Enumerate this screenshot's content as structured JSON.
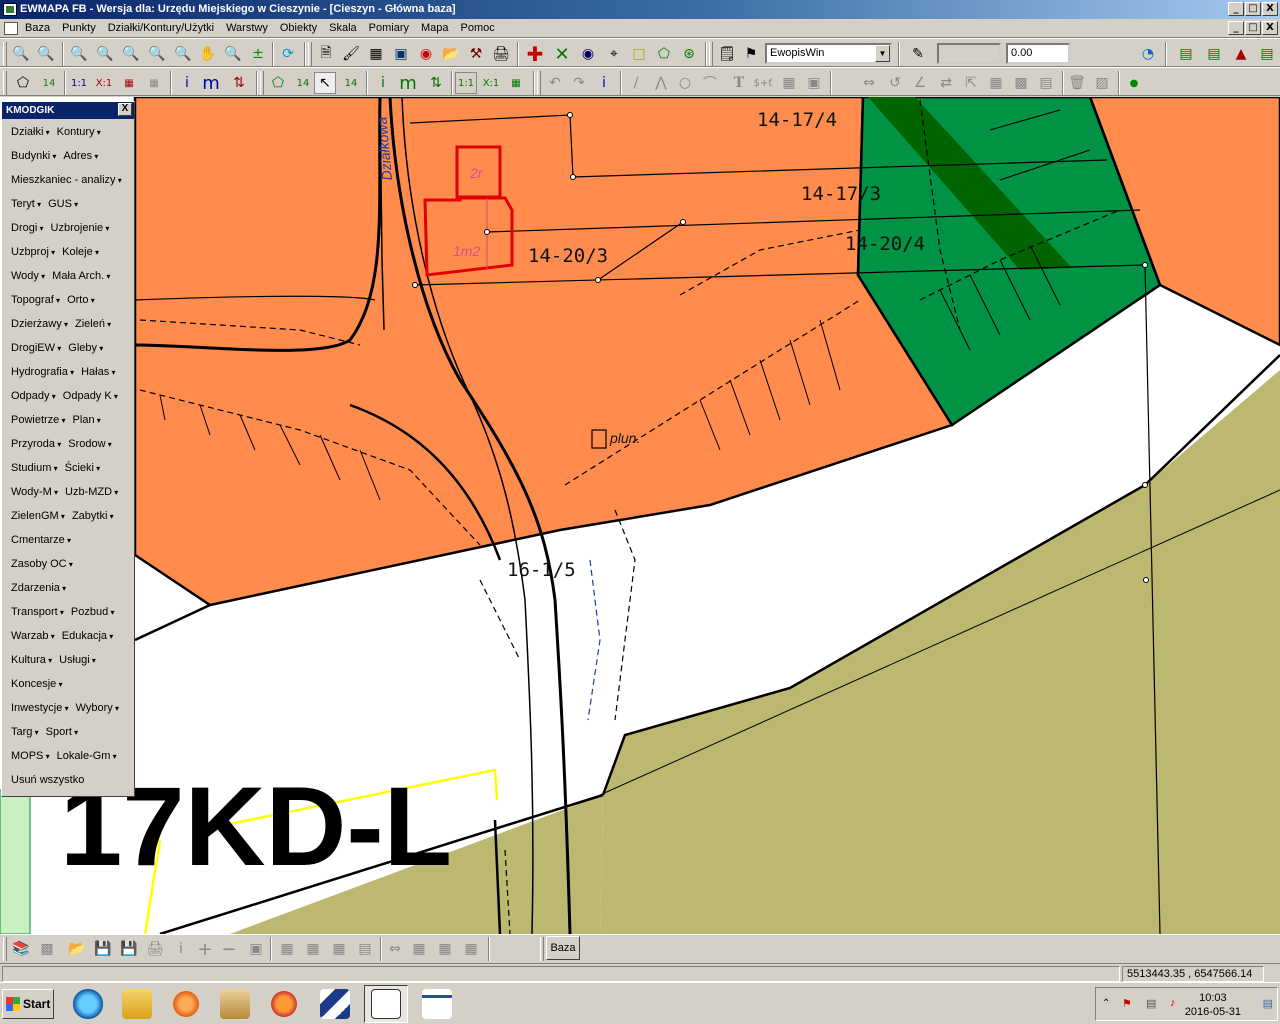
{
  "window": {
    "title": "EWMAPA FB - Wersja dla: Urzędu Miejskiego w Cieszynie - [Cieszyn - Główna baza]",
    "caption_buttons": [
      "_",
      "□",
      "X"
    ]
  },
  "menubar": {
    "items": [
      "Baza",
      "Punkty",
      "Działki/Kontury/Użytki",
      "Warstwy",
      "Obiekty",
      "Skala",
      "Pomiary",
      "Mapa",
      "Pomoc"
    ]
  },
  "toolbar": {
    "layer_combo": "EwopisWin",
    "value_field": "0.00",
    "info_i": "i",
    "info_m": "m",
    "text_tool": "T",
    "text_tool2": "$+ť",
    "measure_1_1": "1:1",
    "measure_x1": "X:1",
    "measure_14": "14"
  },
  "panel": {
    "title": "KMODGIK",
    "close": "X",
    "rows": [
      [
        "Działki",
        "Kontury"
      ],
      [
        "Budynki",
        "Adres"
      ],
      [
        "Mieszkaniec - analizy"
      ],
      [
        "Teryt",
        "GUS"
      ],
      [
        "Drogi",
        "Uzbrojenie"
      ],
      [
        "Uzbproj",
        "Koleje"
      ],
      [
        "Wody",
        "Mała Arch."
      ],
      [
        "Topograf",
        "Orto"
      ],
      [
        "Dzierżawy",
        "Zieleń"
      ],
      [
        "DrogiEW",
        "Gleby"
      ],
      [
        "Hydrografia",
        "Hałas"
      ],
      [
        "Odpady",
        "Odpady K"
      ],
      [
        "Powietrze",
        "Plan"
      ],
      [
        "Przyroda",
        "Srodow"
      ],
      [
        "Studium",
        "Ścieki"
      ],
      [
        "Wody-M",
        "Uzb-MZD"
      ],
      [
        "ZielenGM",
        "Zabytki"
      ],
      [
        "Cmentarze"
      ],
      [
        "Zasoby OC"
      ],
      [
        "Zdarzenia"
      ],
      [
        "Transport",
        "Pozbud"
      ],
      [
        "Warzab",
        "Edukacja"
      ],
      [
        "Kultura",
        "Usługi"
      ],
      [
        "Koncesje"
      ],
      [
        "Inwestycje",
        "Wybory"
      ],
      [
        "Targ",
        "Sport"
      ],
      [
        "MOPS",
        "Lokale-Gm"
      ],
      [
        "Usuń wszystko"
      ]
    ]
  },
  "map": {
    "street_label": "Działkowa",
    "parcel_labels": [
      "14-17/4",
      "14-17/3",
      "14-20/3",
      "14-20/4",
      "16-1/5"
    ],
    "building_labels": [
      "2r",
      "1m2",
      "plun."
    ],
    "zone_label": "17KD-L",
    "colors": {
      "residential": "#ff8c4d",
      "green": "#009245",
      "dark_green": "#006400",
      "agricultural": "#bdb86f",
      "parcel_red": "#e00000",
      "boundary_yellow": "#ffff00"
    }
  },
  "statusbar": {
    "base_button": "Baza",
    "coordinates": "5513443.35 , 6547566.14"
  },
  "taskbar": {
    "start_label": "Start",
    "time": "10:03",
    "date": "2016-05-31"
  }
}
